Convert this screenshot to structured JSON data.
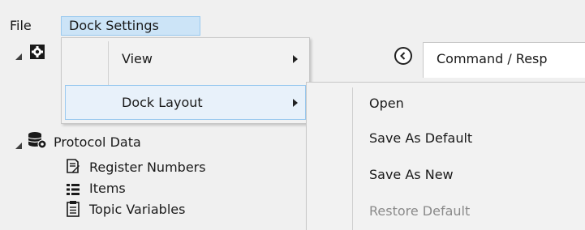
{
  "menubar": {
    "file": "File",
    "dock_settings": "Dock Settings"
  },
  "dock_settings_menu": {
    "items": [
      {
        "label": "View",
        "has_submenu": true
      },
      {
        "label": "Dock Layout",
        "has_submenu": true,
        "highlighted": true
      }
    ]
  },
  "dock_layout_submenu": {
    "items": [
      {
        "label": "Open",
        "enabled": true
      },
      {
        "label": "Save As Default",
        "enabled": true
      },
      {
        "label": "Save As New",
        "enabled": true
      },
      {
        "label": "Restore Default",
        "enabled": false
      }
    ]
  },
  "tree": {
    "root_icon": "gear-icon",
    "protocol_data": {
      "label": "Protocol Data",
      "icon": "database-gear-icon",
      "children": [
        {
          "label": "Register Numbers",
          "icon": "register-icon"
        },
        {
          "label": "Items",
          "icon": "list-icon"
        },
        {
          "label": "Topic Variables",
          "icon": "document-icon"
        }
      ]
    }
  },
  "document_tab": {
    "label": "Command / Resp"
  },
  "colors": {
    "menu_highlight": "#cce4f7",
    "menu_highlight_border": "#99c9ef",
    "disabled_text": "#8a8a8a"
  }
}
